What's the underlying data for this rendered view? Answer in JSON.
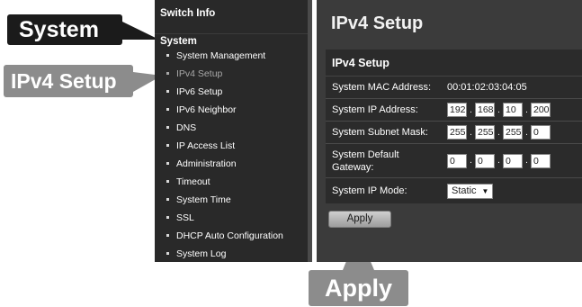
{
  "callouts": {
    "system": "System",
    "ipv4_setup": "IPv4 Setup",
    "apply": "Apply"
  },
  "sidebar": {
    "header": "Switch Info",
    "group": "System",
    "items": [
      {
        "label": "System Management",
        "active": false
      },
      {
        "label": "IPv4 Setup",
        "active": true
      },
      {
        "label": "IPv6 Setup",
        "active": false
      },
      {
        "label": "IPv6 Neighbor",
        "active": false
      },
      {
        "label": "DNS",
        "active": false
      },
      {
        "label": "IP Access List",
        "active": false
      },
      {
        "label": "Administration",
        "active": false
      },
      {
        "label": "Timeout",
        "active": false
      },
      {
        "label": "System Time",
        "active": false
      },
      {
        "label": "SSL",
        "active": false
      },
      {
        "label": "DHCP Auto Configuration",
        "active": false
      },
      {
        "label": "System Log",
        "active": false
      }
    ]
  },
  "main": {
    "page_title": "IPv4 Setup",
    "panel_title": "IPv4 Setup",
    "mac_label": "System MAC Address:",
    "mac_value": "00:01:02:03:04:05",
    "ip_label": "System IP Address:",
    "ip": [
      "192",
      "168",
      "10",
      "200"
    ],
    "mask_label": "System Subnet Mask:",
    "mask": [
      "255",
      "255",
      "255",
      "0"
    ],
    "gateway_label": "System Default Gateway:",
    "gateway": [
      "0",
      "0",
      "0",
      "0"
    ],
    "mode_label": "System IP Mode:",
    "mode_value": "Static",
    "apply_label": "Apply"
  },
  "colors": {
    "sidebar_bg": "#292929",
    "main_bg": "#3b3b3b",
    "panel_bg": "#2b2b2b",
    "callout_dark": "#1b1b1b",
    "callout_gray": "#8c8c8c"
  }
}
